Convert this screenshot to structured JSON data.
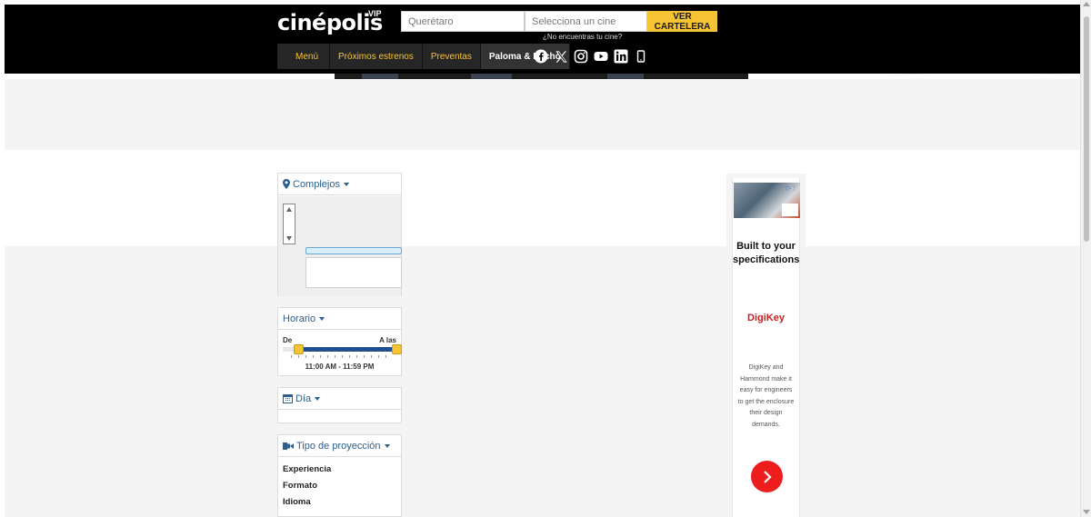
{
  "header": {
    "logo_text": "cinépolis",
    "logo_vip": "VIP",
    "city_value": "Querétaro",
    "cinema_placeholder": "Selecciona un cine",
    "search_button": "VER CARTELERA",
    "help_link": "¿No encuentras tu cine?",
    "nav": [
      {
        "label": "Menú"
      },
      {
        "label": "Próximos estrenos"
      },
      {
        "label": "Preventas"
      },
      {
        "label": "Paloma & Nacho"
      }
    ],
    "social_icons": [
      "facebook-icon",
      "x-icon",
      "instagram-icon",
      "youtube-icon",
      "linkedin-icon",
      "phone-icon"
    ]
  },
  "filters": {
    "complejos": {
      "title": "Complejos"
    },
    "horario": {
      "title": "Horario",
      "from_label": "De",
      "to_label": "A las",
      "range_text": "11:00 AM - 11:59 PM"
    },
    "dia": {
      "title": "Día"
    },
    "tipo": {
      "title": "Tipo de proyección",
      "options": [
        "Experiencia",
        "Formato",
        "Idioma"
      ]
    }
  },
  "ad": {
    "headline": "Built to your specifications",
    "brand": "DigiKey",
    "body": "DigiKey and Hammond make it easy for engineers to get the enclosure their design demands."
  },
  "colors": {
    "header_bg": "#000000",
    "accent_yellow": "#f6c433",
    "link_blue": "#2c5f8e",
    "slider_blue": "#1f4e8c",
    "ad_red": "#ee1d1d"
  }
}
